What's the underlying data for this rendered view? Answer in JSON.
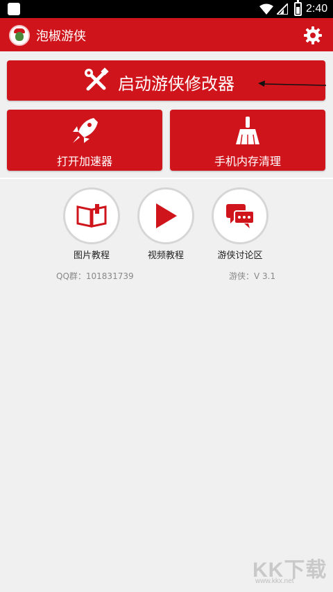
{
  "status_bar": {
    "time": "2:40",
    "icons": [
      "notification-icon",
      "wifi-icon",
      "cellular-icon",
      "battery-icon"
    ]
  },
  "app_bar": {
    "title": "泡椒游侠",
    "logo_icon": "app-logo-icon",
    "settings_icon": "gear-icon"
  },
  "main_button": {
    "label": "启动游侠修改器",
    "icon": "wrench-screwdriver-icon"
  },
  "quick_actions": [
    {
      "label": "打开加速器",
      "icon": "rocket-icon"
    },
    {
      "label": "手机内存清理",
      "icon": "broom-icon"
    }
  ],
  "links": [
    {
      "label": "图片教程",
      "icon": "book-icon"
    },
    {
      "label": "视频教程",
      "icon": "play-icon"
    },
    {
      "label": "游侠讨论区",
      "icon": "chat-bubbles-icon"
    }
  ],
  "info": {
    "qq_group": "QQ群：101831739",
    "version": "游侠：V 3.1"
  },
  "watermark": {
    "brand": "KK下载",
    "url": "www.kkx.net"
  },
  "colors": {
    "primary": "#d0141b",
    "background": "#f0f0f0",
    "circle_border": "#d6d6d6"
  }
}
